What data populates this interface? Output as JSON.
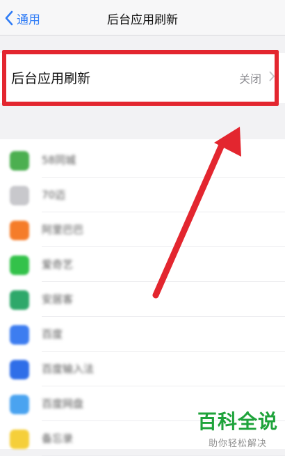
{
  "nav": {
    "back_label": "通用",
    "title": "后台应用刷新"
  },
  "setting": {
    "label": "后台应用刷新",
    "value": "关闭"
  },
  "description": "",
  "apps": [
    {
      "name": "58同城",
      "color": "#4caf50"
    },
    {
      "name": "70迈",
      "color": "#c8c8cc"
    },
    {
      "name": "阿里巴巴",
      "color": "#f57c2a"
    },
    {
      "name": "爱奇艺",
      "color": "#33c24a"
    },
    {
      "name": "安居客",
      "color": "#2ea86a"
    },
    {
      "name": "百度",
      "color": "#3d7df0"
    },
    {
      "name": "百度输入法",
      "color": "#2f6ee8"
    },
    {
      "name": "百度网盘",
      "color": "#4aa3f0"
    },
    {
      "name": "备忘录",
      "color": "#f5cf3a"
    }
  ],
  "watermark": {
    "title": "百科全说",
    "subtitle": "助你轻松解决"
  },
  "colors": {
    "accent": "#2f7cf6",
    "highlight": "#e3262f",
    "watermark": "#1fa33b"
  }
}
